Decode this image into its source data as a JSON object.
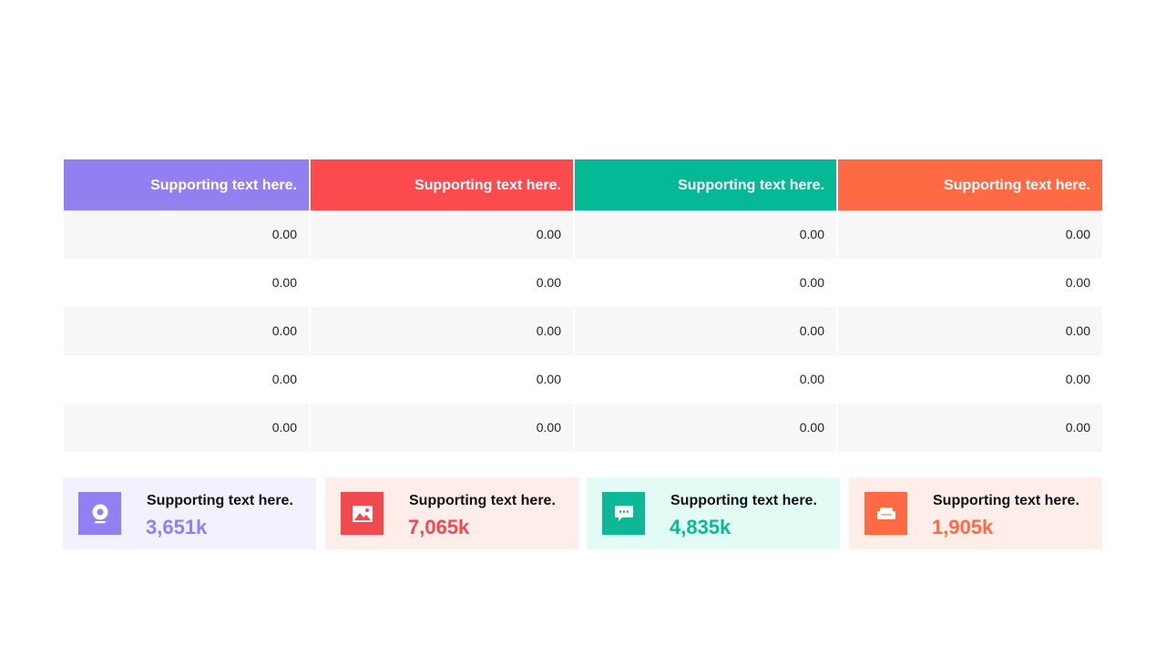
{
  "table": {
    "headers": [
      {
        "label": "Supporting text here.",
        "color": "#9380f0"
      },
      {
        "label": "Supporting text here.",
        "color": "#fb4b4e"
      },
      {
        "label": "Supporting text here.",
        "color": "#05b996"
      },
      {
        "label": "Supporting text here.",
        "color": "#fe6a43"
      }
    ],
    "rows": [
      [
        "0.00",
        "0.00",
        "0.00",
        "0.00"
      ],
      [
        "0.00",
        "0.00",
        "0.00",
        "0.00"
      ],
      [
        "0.00",
        "0.00",
        "0.00",
        "0.00"
      ],
      [
        "0.00",
        "0.00",
        "0.00",
        "0.00"
      ],
      [
        "0.00",
        "0.00",
        "0.00",
        "0.00"
      ]
    ]
  },
  "cards": [
    {
      "label": "Supporting text here.",
      "value": "3,651k",
      "icon": "webcam-icon",
      "accent": "#9380f0",
      "background": "#f3f1fd"
    },
    {
      "label": "Supporting text here.",
      "value": "7,065k",
      "icon": "image-icon",
      "accent": "#f14a4e",
      "background": "#feede9"
    },
    {
      "label": "Supporting text here.",
      "value": "4,835k",
      "icon": "chat-bubble-icon",
      "accent": "#0cb896",
      "background": "#e2fcf5"
    },
    {
      "label": "Supporting text here.",
      "value": "1,905k",
      "icon": "sofa-icon",
      "accent": "#fe6a43",
      "background": "#feede9"
    }
  ]
}
